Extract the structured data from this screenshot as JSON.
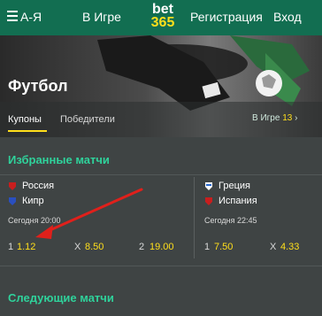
{
  "nav": {
    "az_label": "А-Я",
    "inplay_label": "В Игре",
    "logo_top": "bet",
    "logo_bottom": "365",
    "register_label": "Регистрация",
    "login_label": "Вход"
  },
  "hero": {
    "title": "Футбол",
    "tabs": [
      "Купоны",
      "Победители"
    ],
    "inplay_label": "В Игре",
    "inplay_count": "13",
    "inplay_chevron": "›"
  },
  "featured": {
    "title": "Избранные матчи",
    "matches": [
      {
        "team1": "Россия",
        "team2": "Кипр",
        "date": "Сегодня 20:00",
        "odds": [
          {
            "label": "1",
            "value": "1.12"
          },
          {
            "label": "X",
            "value": "8.50"
          },
          {
            "label": "2",
            "value": "19.00"
          }
        ]
      },
      {
        "team1": "Греция",
        "team2": "Испания",
        "date": "Сегодня 22:45",
        "odds": [
          {
            "label": "1",
            "value": "7.50"
          },
          {
            "label": "X",
            "value": "4.33"
          }
        ]
      }
    ]
  },
  "upcoming": {
    "title": "Следующие матчи"
  },
  "colors": {
    "nav_green": "#126e51",
    "accent_yellow": "#ffdf1b",
    "section_green": "#2fd29b",
    "arrow_red": "#e0201b"
  }
}
